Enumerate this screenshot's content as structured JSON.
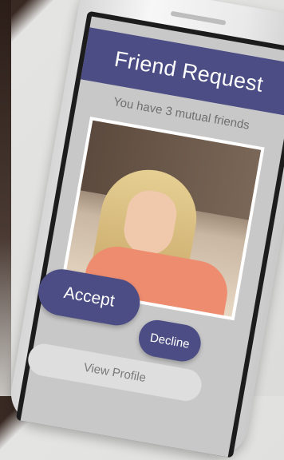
{
  "header": {
    "title": "Friend Request"
  },
  "request": {
    "mutual_friends_text": "You have 3 mutual friends"
  },
  "actions": {
    "accept_label": "Accept",
    "decline_label": "Decline",
    "view_profile_label": "View Profile"
  },
  "colors": {
    "accent": "#4b4d84",
    "screen_bg": "#c8c8c8",
    "phone_body": "#eeeeee"
  }
}
